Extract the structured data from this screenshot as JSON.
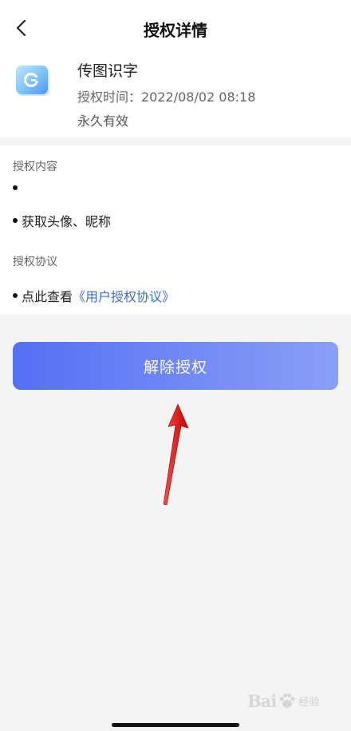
{
  "nav": {
    "title": "授权详情",
    "back_icon": "chevron-left-icon"
  },
  "app": {
    "name": "传图识字",
    "auth_time": "授权时间：2022/08/02 08:18",
    "validity": "永久有效",
    "icon": "app-logo-icon"
  },
  "content": {
    "section_title": "授权内容",
    "items": [
      "",
      "获取头像、昵称"
    ]
  },
  "agreement": {
    "section_title": "授权协议",
    "prefix": "点此查看",
    "link": "《用户授权协议》"
  },
  "revoke_button": {
    "label": "解除授权"
  },
  "annotation": {
    "arrow_icon": "red-arrow-icon"
  },
  "watermark": {
    "text": "Bai",
    "sub": "经验"
  },
  "colors": {
    "link": "#3d6fc9",
    "button_start": "#5470f4",
    "button_end": "#8a9ff6",
    "page_bg": "#f4f4f4"
  }
}
